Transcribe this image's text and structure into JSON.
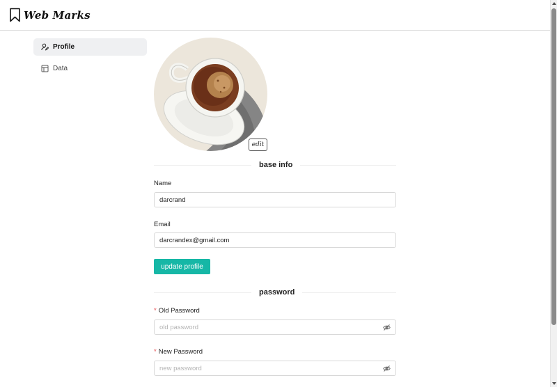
{
  "app": {
    "title": "Web Marks"
  },
  "sidebar": {
    "items": [
      {
        "label": "Profile",
        "icon": "user-edit-icon",
        "active": true
      },
      {
        "label": "Data",
        "icon": "table-icon",
        "active": false
      }
    ]
  },
  "profile": {
    "avatar_edit_label": "edit"
  },
  "base_info": {
    "section_title": "base info",
    "name_label": "Name",
    "name_value": "darcrand",
    "email_label": "Email",
    "email_value": "darcrandex@gmail.com",
    "submit_label": "update profile"
  },
  "password": {
    "section_title": "password",
    "old_label": "Old Password",
    "old_placeholder": "old password",
    "new_label": "New Password",
    "new_placeholder": "new password",
    "required_mark": "*"
  },
  "colors": {
    "accent": "#16b7a6",
    "required": "#e5484d"
  }
}
